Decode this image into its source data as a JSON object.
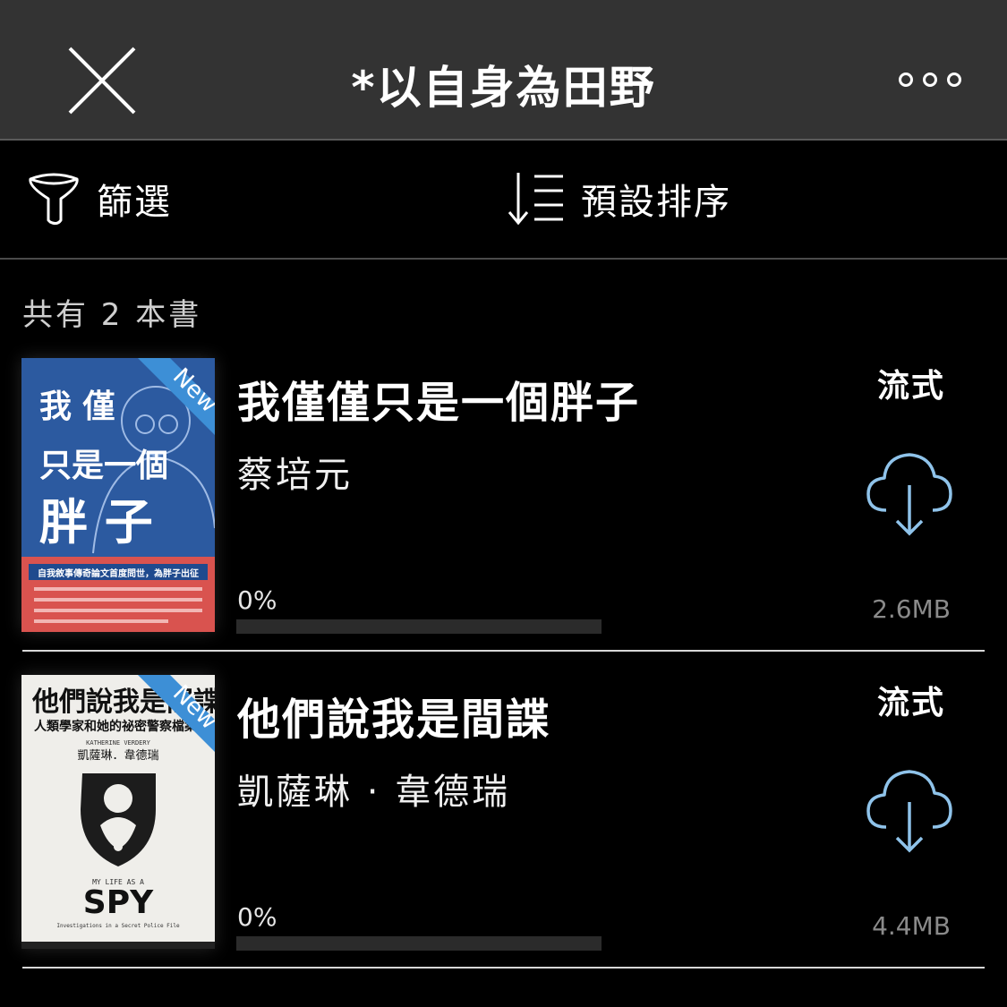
{
  "header": {
    "title": "*以自身為田野",
    "close_icon": "close-icon",
    "more_icon": "more-dots-icon"
  },
  "toolbar": {
    "filter_label": "篩選",
    "filter_icon": "funnel-icon",
    "sort_label": "預設排序",
    "sort_icon": "sort-icon"
  },
  "summary": {
    "count_text": "共有 2 本書"
  },
  "books": [
    {
      "title": "我僅僅只是一個胖子",
      "author": "蔡培元",
      "progress_text": "0%",
      "progress": 0,
      "mode": "流式",
      "size": "2.6MB",
      "badge": "New",
      "cover": {
        "line1": "我  僅",
        "line2": "只是一個",
        "line3": "胖  子",
        "banner": "自我敘事傳奇論文首度問世，為胖子出征"
      }
    },
    {
      "title": "他們說我是間諜",
      "author": "凱薩琳 · 韋德瑞",
      "progress_text": "0%",
      "progress": 0,
      "mode": "流式",
      "size": "4.4MB",
      "badge": "New",
      "cover": {
        "title_top": "他們說我是間諜",
        "subtitle": "人類學家和她的祕密警察檔案",
        "author_cn": "凱薩琳．韋德瑞",
        "author_en": "KATHERINE VERDERY",
        "en_title_small": "MY  LIFE  AS  A",
        "en_title_big": "SPY",
        "en_sub": "Investigations in a Secret Police File"
      }
    }
  ],
  "colors": {
    "header_bg": "#333333",
    "accent_blue": "#6ba7d8",
    "badge_blue": "#3d8fd6",
    "cover1_blue": "#2c5aa0",
    "cover1_red": "#d9534f"
  }
}
